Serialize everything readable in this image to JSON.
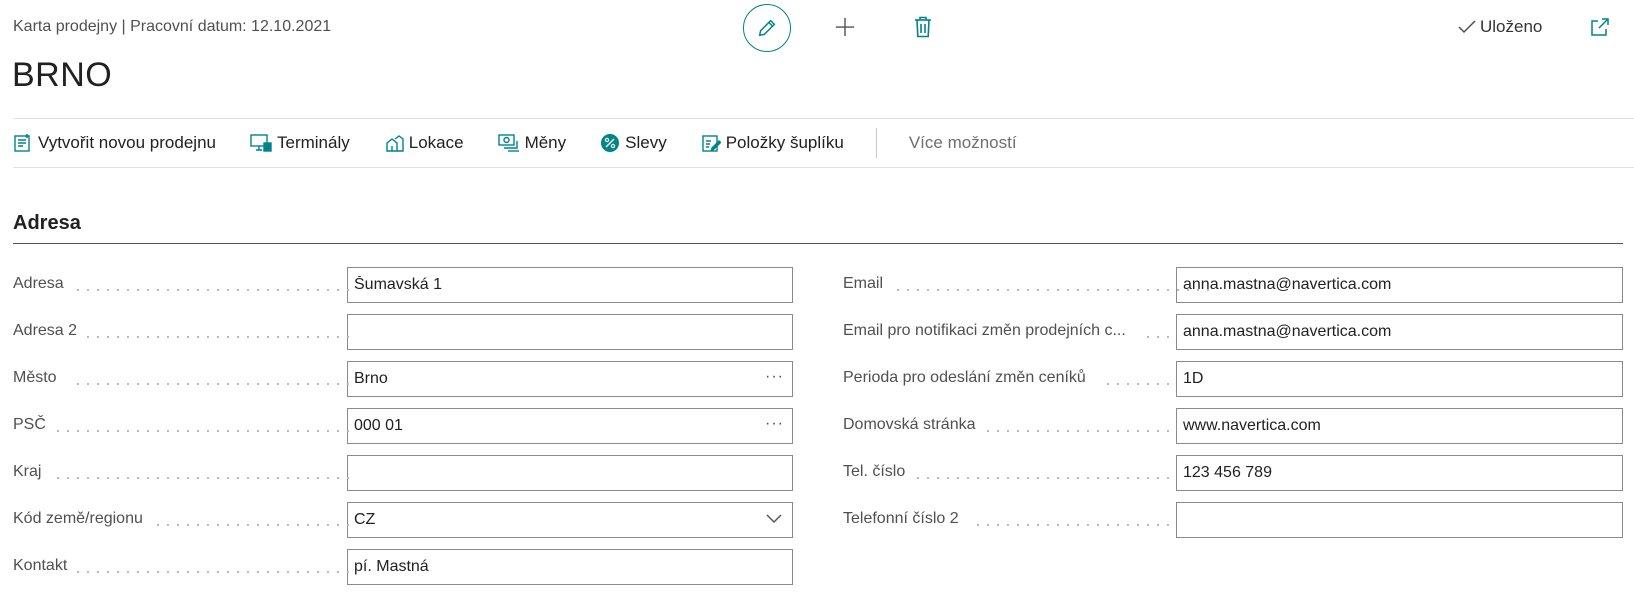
{
  "header": {
    "breadcrumb": "Karta prodejny | Pracovní datum: 12.10.2021",
    "title": "BRNO",
    "saved_label": "Uloženo",
    "accent_color": "#008489"
  },
  "actions": [
    {
      "label": "Vytvořit novou prodejnu",
      "icon": "new-store-icon"
    },
    {
      "label": "Terminály",
      "icon": "terminal-icon"
    },
    {
      "label": "Lokace",
      "icon": "location-icon"
    },
    {
      "label": "Měny",
      "icon": "currency-icon"
    },
    {
      "label": "Slevy",
      "icon": "discount-icon"
    },
    {
      "label": "Položky šuplíku",
      "icon": "drawer-items-icon"
    }
  ],
  "more_label": "Více možností",
  "section": {
    "title": "Adresa"
  },
  "left_fields": [
    {
      "label": "Adresa",
      "value": "Šumavská 1",
      "control": "text"
    },
    {
      "label": "Adresa 2",
      "value": "",
      "control": "text"
    },
    {
      "label": "Město",
      "value": "Brno",
      "control": "lookup"
    },
    {
      "label": "PSČ",
      "value": "000 01",
      "control": "lookup"
    },
    {
      "label": "Kraj",
      "value": "",
      "control": "text"
    },
    {
      "label": "Kód země/regionu",
      "value": "CZ",
      "control": "dropdown"
    },
    {
      "label": "Kontakt",
      "value": "pí. Mastná",
      "control": "text"
    }
  ],
  "right_fields": [
    {
      "label": "Email",
      "value": "anna.mastna@navertica.com",
      "control": "text"
    },
    {
      "label": "Email pro notifikaci změn prodejních c...",
      "value": "anna.mastna@navertica.com",
      "control": "text"
    },
    {
      "label": "Perioda pro odeslání změn ceníků",
      "value": "1D",
      "control": "text"
    },
    {
      "label": "Domovská stránka",
      "value": "www.navertica.com",
      "control": "text"
    },
    {
      "label": "Tel. číslo",
      "value": "123 456 789",
      "control": "text"
    },
    {
      "label": "Telefonní číslo 2",
      "value": "",
      "control": "text"
    }
  ]
}
